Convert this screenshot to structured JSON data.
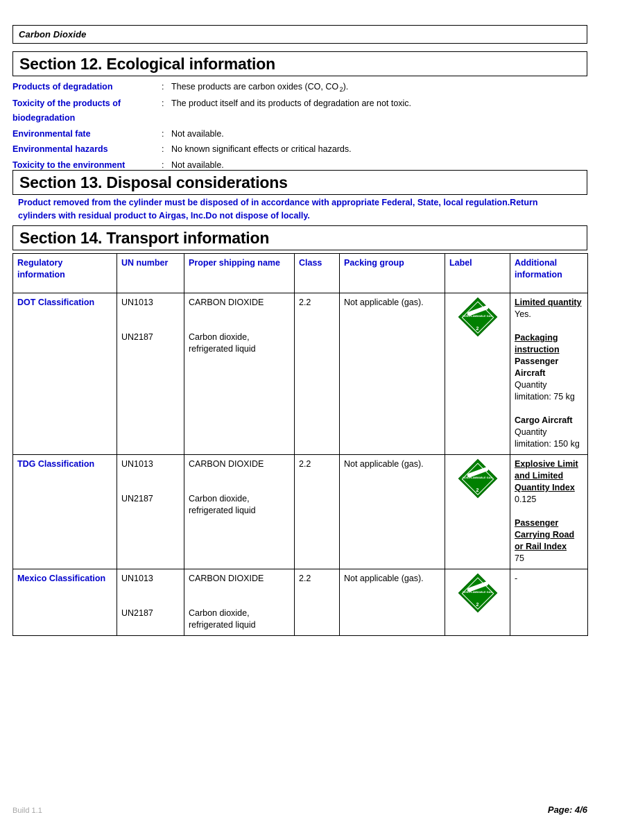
{
  "document": {
    "product_name": "Carbon Dioxide"
  },
  "section12": {
    "heading": "Section 12. Ecological information",
    "colon": ":",
    "fields": [
      {
        "label": "Products of degradation",
        "value_prefix": "These products are carbon oxides (CO, CO",
        "value_sub": "2",
        "value_suffix": ")."
      },
      {
        "label": "Toxicity of the products of biodegradation",
        "value": "The product itself and its products of degradation are not toxic."
      },
      {
        "label": "Environmental fate",
        "value": "Not available."
      },
      {
        "label": "Environmental hazards",
        "value": "No known significant effects or critical hazards."
      },
      {
        "label": "Toxicity to the environment",
        "value": "Not available."
      }
    ]
  },
  "section13": {
    "heading": "Section 13. Disposal considerations",
    "body": "Product removed from the cylinder must be disposed of in accordance with appropriate Federal, State, local regulation.Return cylinders with residual product to Airgas, Inc.Do not dispose of locally."
  },
  "section14": {
    "heading": "Section 14. Transport information",
    "columns": [
      "Regulatory information",
      "UN number",
      "Proper shipping name",
      "Class",
      "Packing group",
      "Label",
      "Additional information"
    ],
    "hazard_label": {
      "icon": "non-flammable-gas-diamond-icon",
      "text": "NON-FLAMMABLE GAS",
      "class_number": "2",
      "color": "#008000"
    },
    "rows": [
      {
        "regulation": "DOT Classification",
        "un_number_1": "UN1013",
        "un_number_2": "UN2187",
        "shipping_name_1": "CARBON DIOXIDE",
        "shipping_name_2": "Carbon dioxide, refrigerated liquid",
        "class": "2.2",
        "packing_group": "Not applicable (gas).",
        "additional": [
          {
            "heading": "Limited quantity",
            "subheading": "",
            "value": "Yes."
          },
          {
            "heading": "Packaging instruction",
            "subheading": "Passenger Aircraft",
            "value": "Quantity limitation: 75 kg"
          },
          {
            "heading": "",
            "subheading": "Cargo Aircraft",
            "value": "Quantity limitation: 150 kg"
          }
        ]
      },
      {
        "regulation": "TDG Classification",
        "un_number_1": "UN1013",
        "un_number_2": "UN2187",
        "shipping_name_1": "CARBON DIOXIDE",
        "shipping_name_2": "Carbon dioxide, refrigerated liquid",
        "class": "2.2",
        "packing_group": "Not applicable (gas).",
        "additional": [
          {
            "heading": "Explosive Limit and Limited Quantity Index",
            "subheading": "",
            "value": "0.125"
          },
          {
            "heading": "Passenger Carrying Road or Rail Index",
            "subheading": "",
            "value": "75"
          }
        ]
      },
      {
        "regulation": "Mexico Classification",
        "un_number_1": "UN1013",
        "un_number_2": "UN2187",
        "shipping_name_1": "CARBON DIOXIDE",
        "shipping_name_2": "Carbon dioxide, refrigerated liquid",
        "class": "2.2",
        "packing_group": "Not applicable (gas).",
        "additional_plain": "-"
      }
    ]
  },
  "footer": {
    "build": "Build 1.1",
    "page": "Page: 4/6"
  }
}
